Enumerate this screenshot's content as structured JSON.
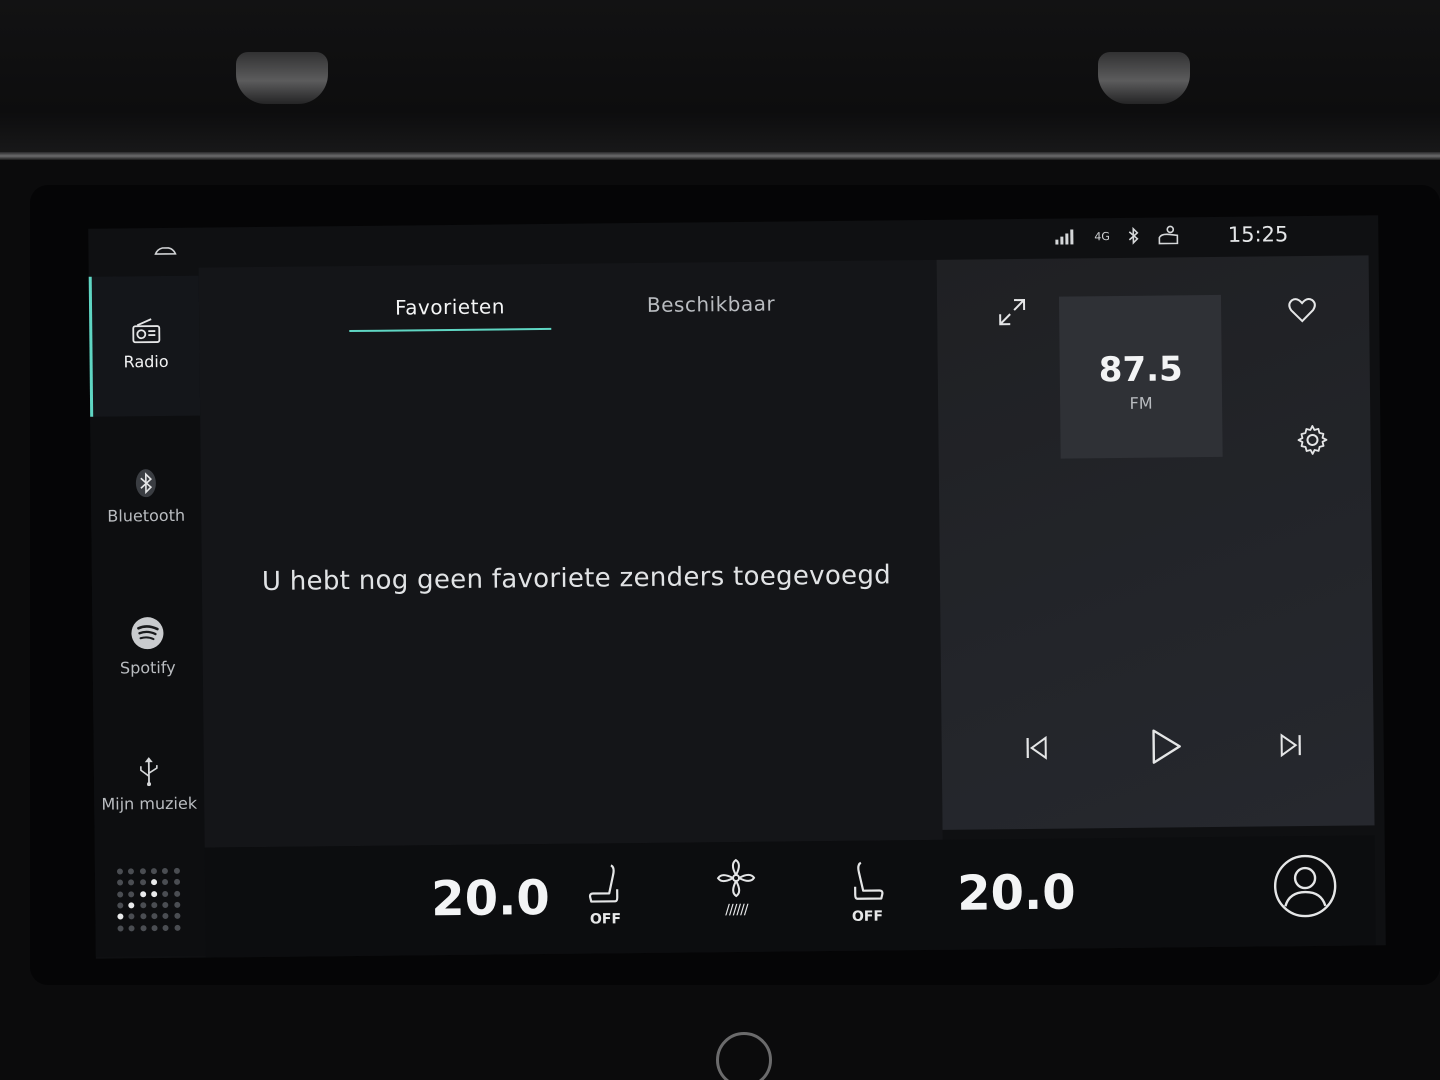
{
  "status": {
    "signal": "signal-bars-icon",
    "network": "4G",
    "clock": "15:25"
  },
  "tabs": [
    {
      "label": "Favorieten",
      "active": true
    },
    {
      "label": "Beschikbaar",
      "active": false
    }
  ],
  "sidebar": {
    "items": [
      {
        "label": "Radio",
        "icon": "radio-icon",
        "active": true
      },
      {
        "label": "Bluetooth",
        "icon": "bluetooth-icon",
        "active": false
      },
      {
        "label": "Spotify",
        "icon": "spotify-icon",
        "active": false
      },
      {
        "label": "Mijn muziek",
        "icon": "usb-icon",
        "active": false
      }
    ]
  },
  "main": {
    "empty_message": "U hebt nog geen favoriete zenders toegevoegd"
  },
  "player": {
    "frequency": "87.5",
    "band": "FM"
  },
  "climate": {
    "temp_left": "20.0",
    "temp_right": "20.0",
    "seat_left_label": "OFF",
    "seat_right_label": "OFF",
    "fan_bars": "//////"
  },
  "colors": {
    "accent": "#5fd6c3",
    "background": "#141518",
    "panel": "#23252a"
  }
}
